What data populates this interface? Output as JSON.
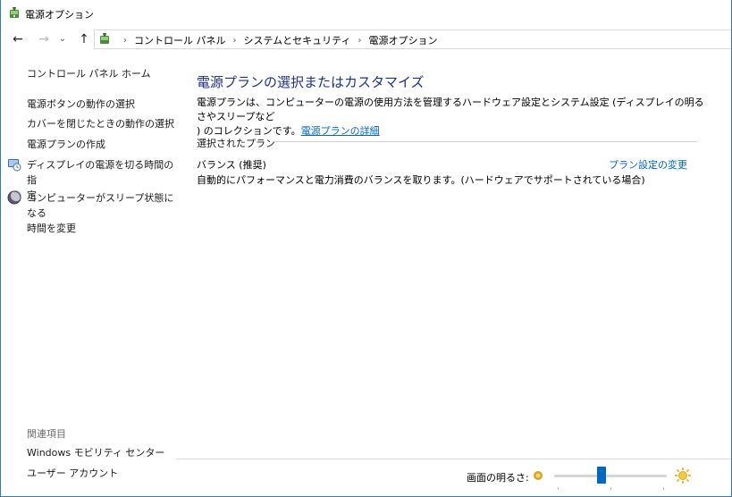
{
  "window": {
    "title": "電源オプション"
  },
  "navigation": {
    "back_glyph": "←",
    "forward_glyph": "→",
    "dropdown_glyph": "⌄",
    "up_glyph": "↑",
    "separator": "›",
    "breadcrumbs": [
      "コントロール パネル",
      "システムとセキュリティ",
      "電源オプション"
    ]
  },
  "sidebar": {
    "home_link": "コントロール パネル ホーム",
    "tasks": [
      {
        "label": "電源ボタンの動作の選択",
        "icon": "none"
      },
      {
        "label": "カバーを閉じたときの動作の選択",
        "icon": "none"
      },
      {
        "label": "電源プランの作成",
        "icon": "none"
      },
      {
        "label_lines": [
          "ディスプレイの電源を切る時間の指",
          "定"
        ],
        "icon": "display-clock-icon"
      },
      {
        "label_lines": [
          "コンピューターがスリープ状態になる",
          "時間を変更"
        ],
        "icon": "moon-icon"
      }
    ],
    "related": {
      "title": "関連項目",
      "items": [
        "Windows モビリティ センター",
        "ユーザー アカウント"
      ]
    }
  },
  "main": {
    "heading": "電源プランの選択またはカスタマイズ",
    "description_line1": "電源プランは、コンピューターの電源の使用方法を管理するハードウェア設定とシステム設定 (ディスプレイの明るさやスリープなど",
    "description_line2_text": ") のコレクションです。",
    "description_link": "電源プランの詳細",
    "selected_section_title": "選択されたプラン",
    "plan": {
      "name": "バランス (推奨)",
      "change_link": "プラン設定の変更",
      "description": "自動的にパフォーマンスと電力消費のバランスを取ります。(ハードウェアでサポートされている場合)"
    }
  },
  "brightness": {
    "label": "画面の明るさ:",
    "level_fraction": 0.42,
    "accent_color": "#0067c0"
  },
  "colors": {
    "link": "#0066cc",
    "heading": "#1e3287",
    "window_border": "#2b79c7"
  }
}
